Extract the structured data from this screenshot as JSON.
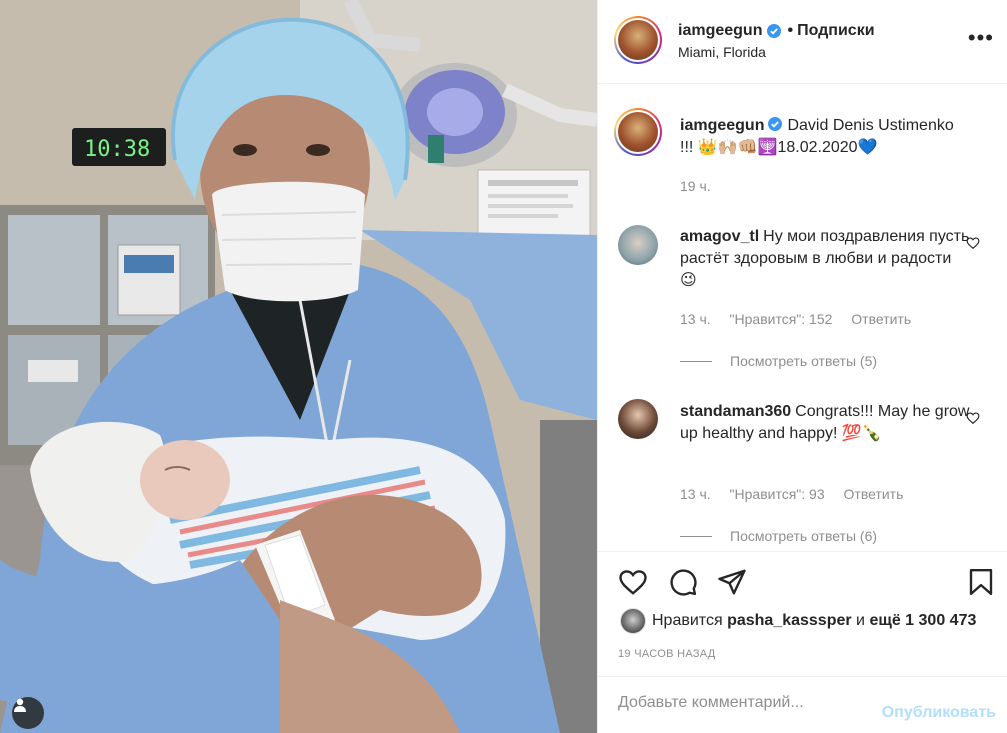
{
  "post": {
    "username": "iamgeegun",
    "separator": "•",
    "follow_label": "Подписки",
    "location": "Miami, Florida",
    "more_label": "•••"
  },
  "caption": {
    "username": "iamgeegun",
    "text": "David Denis Ustimenko !!! 👑🙌🏼👊🏼🕎18.02.2020💙",
    "time": "19 ч."
  },
  "comments": [
    {
      "username": "amagov_tl",
      "text": "Ну мои поздравления пусть растёт здоровым в любви и радости 😉",
      "time": "13 ч.",
      "likes": "\"Нравится\": 152",
      "reply": "Ответить",
      "view_replies": "Посмотреть ответы (5)"
    },
    {
      "username": "standaman360",
      "text": "Congrats!!! May he grow up healthy and happy! 💯🍾",
      "time": "13 ч.",
      "likes": "\"Нравится\": 93",
      "reply": "Ответить",
      "view_replies": "Посмотреть ответы (6)"
    }
  ],
  "likes": {
    "prefix": "Нравится",
    "user": "pasha_kasssper",
    "middle": "и",
    "count": "ещё 1 300 473"
  },
  "time_ago": "19 часов назад",
  "add_comment": {
    "placeholder": "Добавьте комментарий...",
    "post_label": "Опубликовать"
  },
  "photo": {
    "clock_text": "10:38"
  },
  "colors": {
    "accent_link": "#b2dffc",
    "verified": "#3897f0",
    "text": "#262626",
    "secondary": "#8e8e8e"
  },
  "icons": [
    "heart-icon",
    "comment-icon",
    "share-icon",
    "bookmark-icon",
    "verified-icon",
    "more-icon",
    "user-tag-icon"
  ]
}
